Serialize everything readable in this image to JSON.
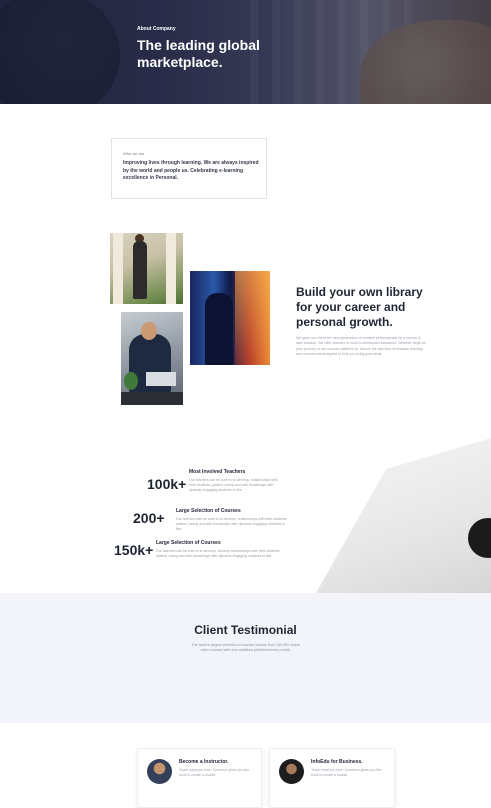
{
  "hero": {
    "eyebrow": "About Company",
    "title": "The leading global marketplace."
  },
  "about": {
    "label": "Who we are",
    "text": "Improving lives through learning. We are always inspired by the world and people us. Celebrating e-learning excellence in Personal."
  },
  "library": {
    "title": "Build your own library for your career and personal growth.",
    "text": "We gave our client the next generation of creative professionals for a course & take solution. We offer courses in most in-demanded industries. Whether begin at your journey or our courses platform to. Unlock the fast kind of rewards learning and commercial designed to help you bring your skills."
  },
  "stats": [
    {
      "number": "100k+",
      "title": "Most Involved Teachers",
      "description": "Our learners can be sure to to develop, relationships with their students, patient, caring and with knowledge offer dynamic engaging students to like."
    },
    {
      "number": "200+",
      "title": "Large Selection of Courses",
      "description": "Our learners can be sure to to develop, relationships with their students, patient, caring and with knowledge offer dynamic engaging students to like."
    },
    {
      "number": "150k+",
      "title": "Large Selection of Courses",
      "description": "Our learners can be sure to to develop, develop relationships with their students, patient, caring and with knowledge offer dynamic engaging students to like."
    }
  ],
  "testimonial": {
    "title": "Client Testimonial",
    "text": "The world's largest selection of courses choose from 100,000 online video courses with new additions published every month"
  },
  "cards": [
    {
      "title": "Become a Instructor.",
      "description": "Teach what you love. Corsebox gives you the tools to create a course."
    },
    {
      "title": "InfoEdu for Business.",
      "description": "Teach what you love. Corsebox gives you the tools to create a course."
    }
  ]
}
